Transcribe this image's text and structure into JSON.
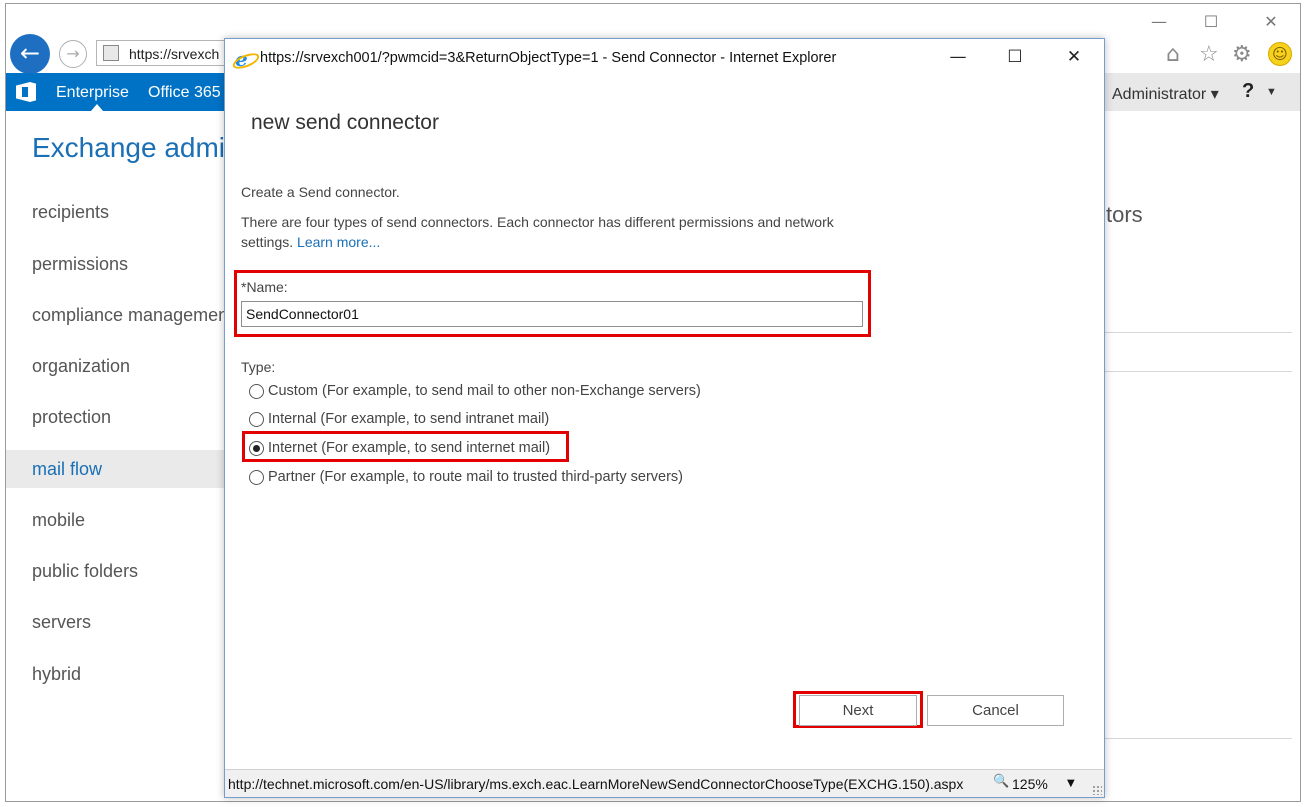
{
  "browser": {
    "address_text": "https://srvexch",
    "window_controls": {
      "minimize": "—",
      "maximize": "☐",
      "close": "✕"
    },
    "toolbar_icons": [
      "home-icon",
      "favorites-star-icon",
      "settings-gear-icon",
      "feedback-smiley-icon"
    ]
  },
  "suite_bar": {
    "links": [
      "Enterprise",
      "Office 365"
    ],
    "user": "Administrator",
    "help": "?",
    "color": "#0072c6"
  },
  "app": {
    "title": "Exchange admin",
    "nav": [
      {
        "label": "recipients"
      },
      {
        "label": "permissions"
      },
      {
        "label": "compliance management"
      },
      {
        "label": "organization"
      },
      {
        "label": "protection"
      },
      {
        "label": "mail flow",
        "selected": true
      },
      {
        "label": "mobile"
      },
      {
        "label": "public folders"
      },
      {
        "label": "servers"
      },
      {
        "label": "hybrid"
      }
    ],
    "partial_right_text": "tors"
  },
  "popup": {
    "window_title": "https://srvexch001/?pwmcid=3&ReturnObjectType=1 - Send Connector - Internet Explorer",
    "heading": "new send connector",
    "intro_line1": "Create a Send connector.",
    "intro_line2": "There are four types of send connectors. Each connector has different permissions and network settings.",
    "learn_more": "Learn more...",
    "name_label": "*Name:",
    "name_value": "SendConnector01",
    "type_label": "Type:",
    "type_options": [
      {
        "label": "Custom (For example, to send mail to other non-Exchange servers)",
        "checked": false
      },
      {
        "label": "Internal (For example, to send intranet mail)",
        "checked": false
      },
      {
        "label": "Internet (For example, to send internet mail)",
        "checked": true
      },
      {
        "label": "Partner (For example, to route mail to trusted third-party servers)",
        "checked": false
      }
    ],
    "buttons": {
      "next": "Next",
      "cancel": "Cancel"
    },
    "status_url": "http://technet.microsoft.com/en-US/library/ms.exch.eac.LearnMoreNewSendConnectorChooseType(EXCHG.150).aspx",
    "zoom": "125%",
    "highlight_color": "#e30000"
  }
}
